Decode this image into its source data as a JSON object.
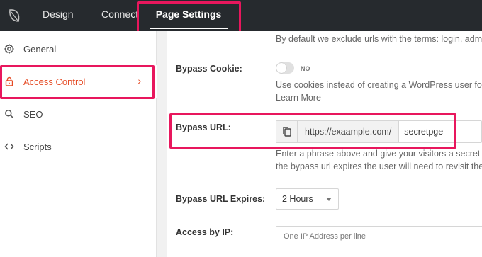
{
  "topbar": {
    "tabs": [
      "Design",
      "Connect",
      "Page Settings"
    ]
  },
  "sidebar": {
    "items": [
      {
        "label": "General",
        "icon": "gear-icon"
      },
      {
        "label": "Access Control",
        "icon": "lock-icon",
        "active": true,
        "chevron": "›"
      },
      {
        "label": "SEO",
        "icon": "search-icon"
      },
      {
        "label": "Scripts",
        "icon": "code-icon"
      }
    ]
  },
  "main": {
    "exclude_note": "By default we exclude urls with the terms: login, admi",
    "bypass_cookie": {
      "label": "Bypass Cookie:",
      "toggle_state": "NO",
      "help_line1": "Use cookies instead of creating a WordPress user for",
      "help_line2": "Learn More"
    },
    "bypass_url": {
      "label": "Bypass URL:",
      "prefix": "https://exaample.com/",
      "value": "secretpge",
      "help_line1": "Enter a phrase above and give your visitors a secret u",
      "help_line2": "the bypass url expires the user will need to revisit the"
    },
    "bypass_url_expires": {
      "label": "Bypass URL Expires:",
      "selected": "2 Hours"
    },
    "access_by_ip": {
      "label": "Access by IP:",
      "placeholder": "One IP Address per line"
    }
  },
  "colors": {
    "accent": "#e54b25",
    "highlight": "#e8175d",
    "topbar": "#262a2e"
  }
}
